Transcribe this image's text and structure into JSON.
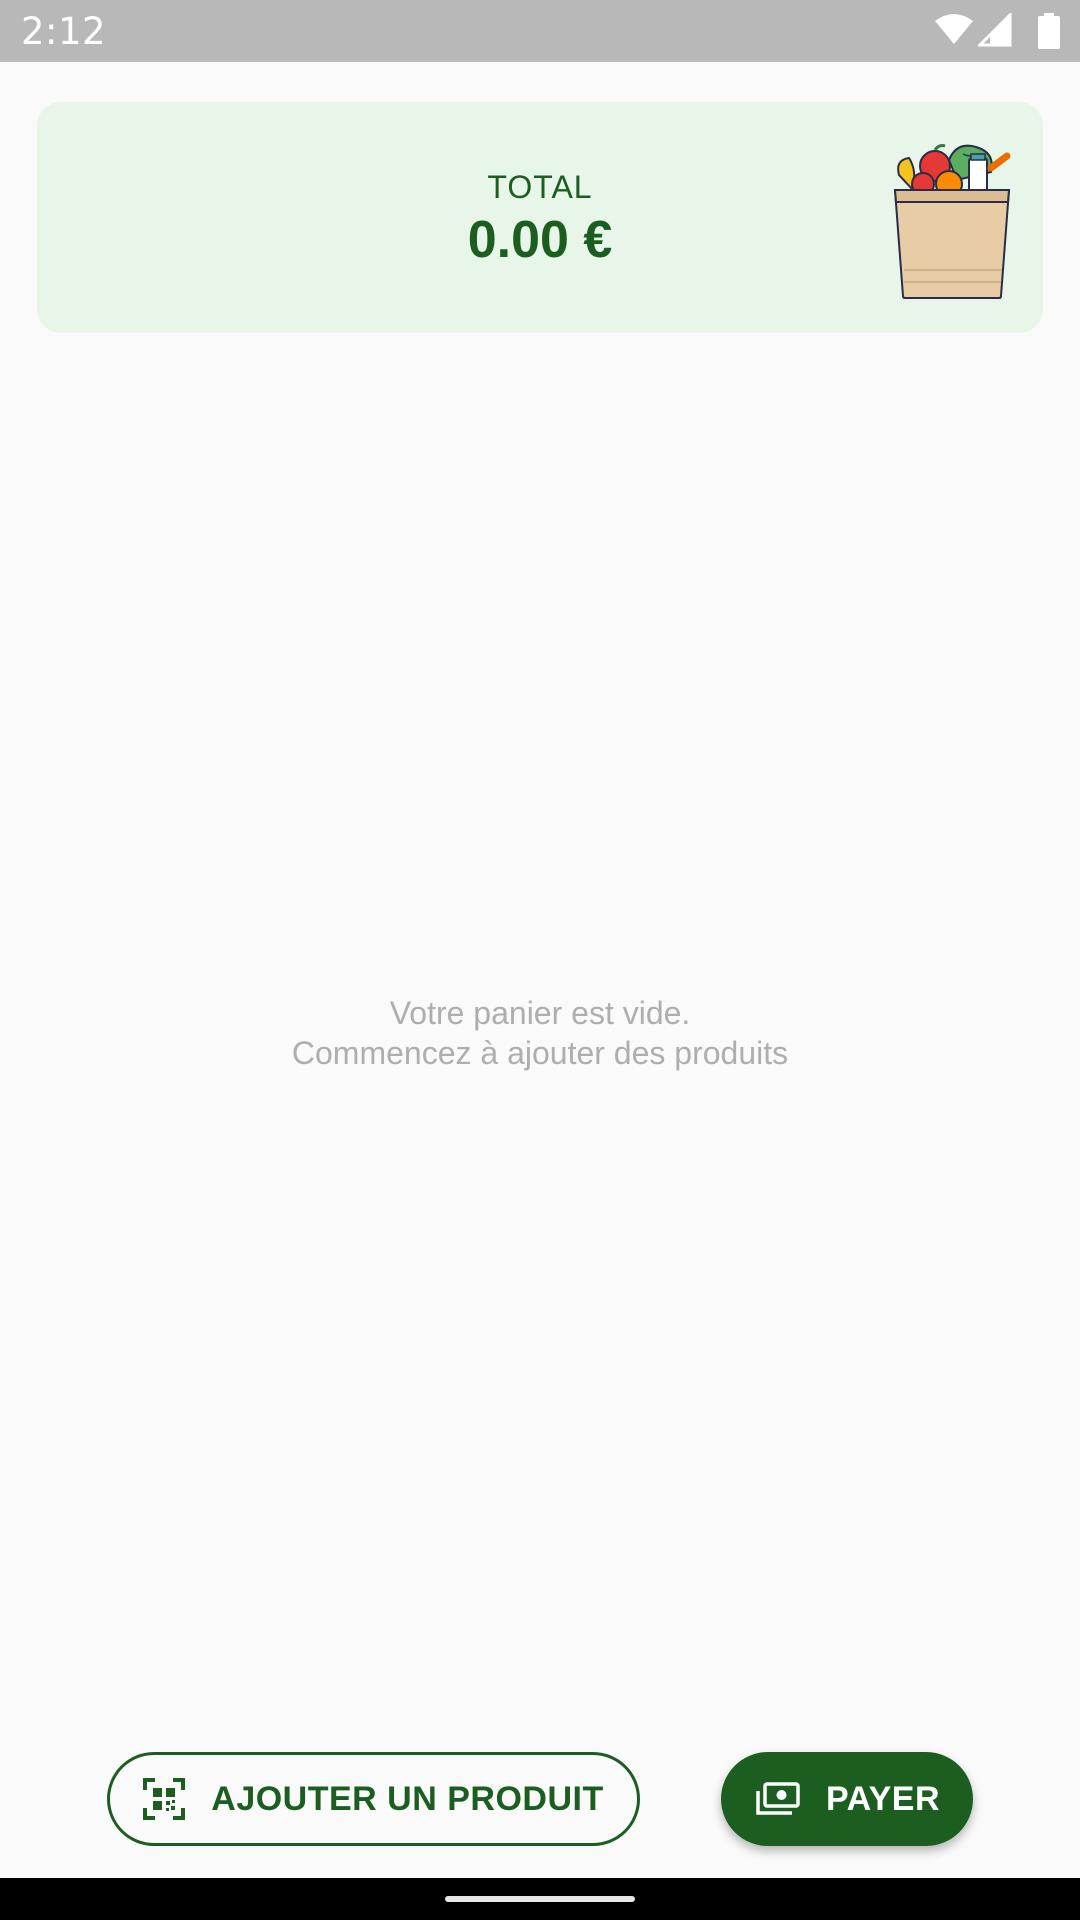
{
  "status_bar": {
    "time": "2:12",
    "icons": [
      "wifi-icon",
      "signal-icon",
      "battery-icon"
    ]
  },
  "total_card": {
    "label": "TOTAL",
    "value": "0.00 €",
    "illustration": "grocery-bag-icon"
  },
  "cart": {
    "empty_line1": "Votre panier est vide.",
    "empty_line2": "Commencez à ajouter des produits"
  },
  "actions": {
    "add_product_label": "AJOUTER UN PRODUIT",
    "add_product_icon": "qr-code-scan-icon",
    "pay_label": "PAYER",
    "pay_icon": "money-icon"
  },
  "colors": {
    "primary": "#1b5e20",
    "card_background": "#e8f5e9",
    "empty_text": "#aeaeae",
    "status_bar": "#b8b8b8"
  }
}
